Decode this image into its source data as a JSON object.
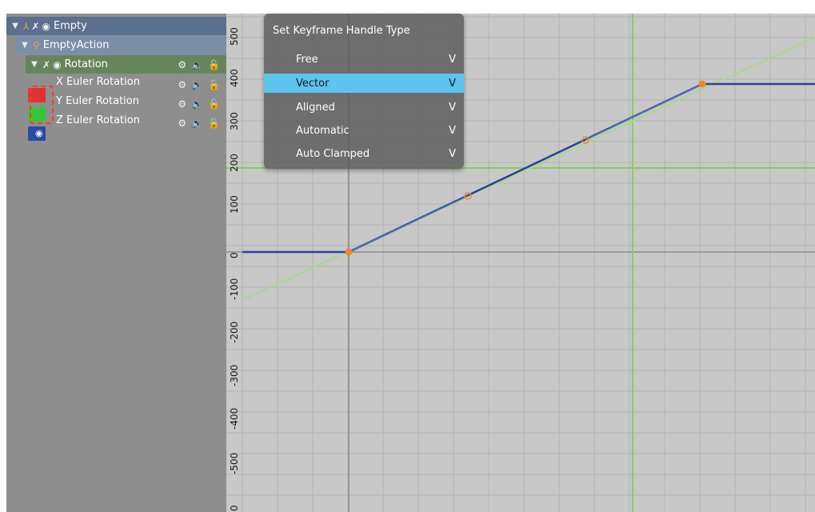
{
  "channels": {
    "object": {
      "label": "Empty",
      "icons": [
        "expand-triangle",
        "axes-icon",
        "pin-icon",
        "eye-icon"
      ]
    },
    "action": {
      "label": "EmptyAction",
      "icons": [
        "expand-triangle",
        "action-icon"
      ]
    },
    "group": {
      "label": "Rotation",
      "icons": [
        "expand-triangle",
        "pin-icon",
        "eye-icon"
      ]
    },
    "fcurves": [
      {
        "label": "X Euler Rotation",
        "color": "#e03232"
      },
      {
        "label": "Y Euler Rotation",
        "color": "#36c636"
      },
      {
        "label": "Z Euler Rotation",
        "color": "#2b4aa5"
      }
    ]
  },
  "graph": {
    "y_ticks": [
      "500",
      "400",
      "300",
      "200",
      "100",
      "0",
      "-100",
      "-200",
      "-300",
      "-400",
      "-500",
      "0"
    ],
    "grid_color": "#b2b2b2",
    "curve_color": "#2b3fa0",
    "cursor_color": "#7fd35a",
    "keyframe_color": "#f08a24"
  },
  "menu": {
    "title": "Set Keyframe Handle Type",
    "items": [
      {
        "label": "Free",
        "shortcut": "V",
        "active": false
      },
      {
        "label": "Vector",
        "shortcut": "V",
        "active": true
      },
      {
        "label": "Aligned",
        "shortcut": "V",
        "active": false
      },
      {
        "label": "Automatic",
        "shortcut": "V",
        "active": false
      },
      {
        "label": "Auto Clamped",
        "shortcut": "V",
        "active": false
      }
    ]
  }
}
